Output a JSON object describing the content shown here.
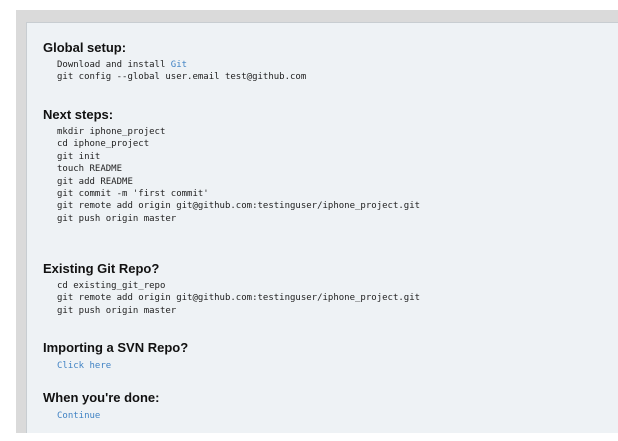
{
  "global_setup": {
    "heading": "Global setup:",
    "line1_text": "Download and install ",
    "line1_link": "Git",
    "line2": "git config --global user.email test@github.com"
  },
  "next_steps": {
    "heading": "Next steps:",
    "lines": [
      "mkdir iphone_project",
      "cd iphone_project",
      "git init",
      "touch README",
      "git add README",
      "git commit -m 'first commit'",
      "git remote add origin git@github.com:testinguser/iphone_project.git",
      "git push origin master"
    ]
  },
  "existing_repo": {
    "heading": "Existing Git Repo?",
    "lines": [
      "cd existing_git_repo",
      "git remote add origin git@github.com:testinguser/iphone_project.git",
      "git push origin master"
    ]
  },
  "svn_import": {
    "heading": "Importing a SVN Repo?",
    "link": "Click here"
  },
  "done": {
    "heading": "When you're done:",
    "link": "Continue"
  },
  "colors": {
    "link": "#4183c4",
    "panel_bg": "#eef2f5",
    "frame_bg": "#dadada"
  }
}
